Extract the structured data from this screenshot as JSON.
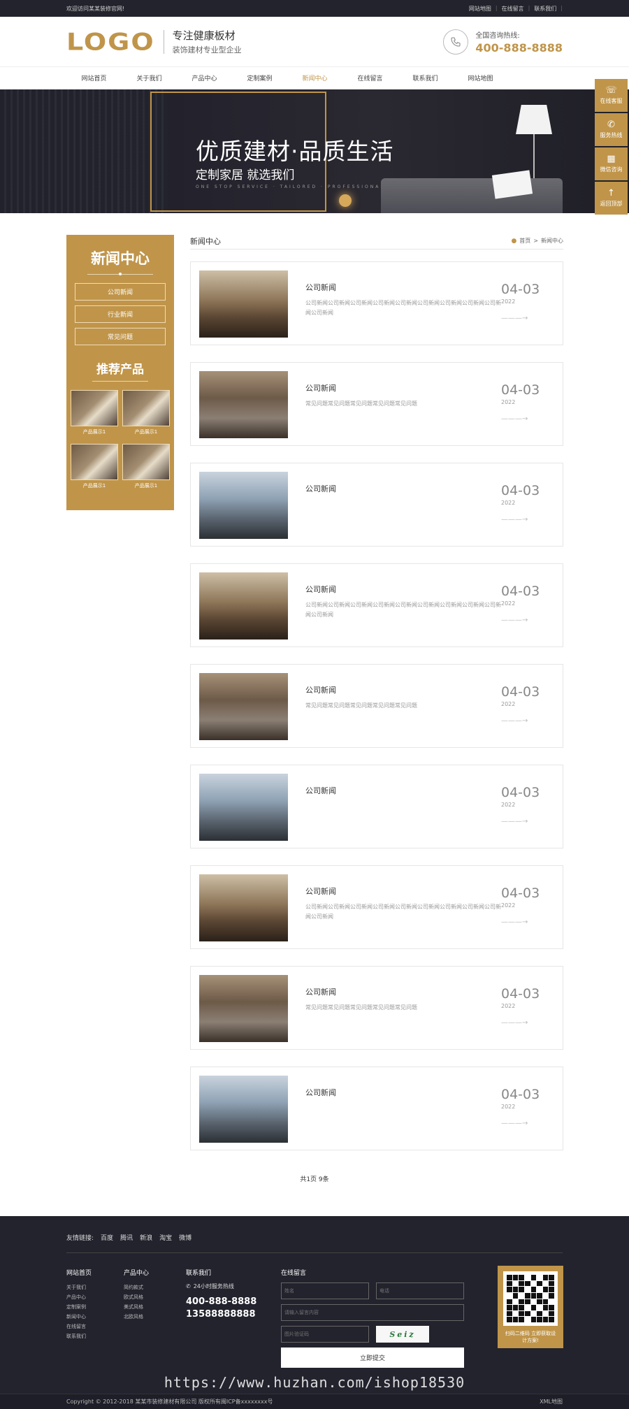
{
  "topbar": {
    "welcome": "欢迎访问某某装修官网!",
    "links": [
      "网站地图",
      "在线留言",
      "联系我们"
    ]
  },
  "header": {
    "logo": "LOGO",
    "slogan_main": "专注健康板材",
    "slogan_sub": "装饰建材专业型企业",
    "hotline_label": "全国咨询热线:",
    "hotline_number": "400-888-8888"
  },
  "nav": {
    "items": [
      "网站首页",
      "关于我们",
      "产品中心",
      "定制案例",
      "新闻中心",
      "在线留言",
      "联系我们",
      "网站地图"
    ],
    "active": "新闻中心"
  },
  "banner": {
    "title": "优质建材·品质生活",
    "subtitle": "定制家居 就选我们",
    "tagline": "ONE STOP SERVICE · TAILORED · PROFESSIONAL INTIMATE"
  },
  "side_float": [
    {
      "label": "在线客服",
      "icon": "headset-icon"
    },
    {
      "label": "服务热线",
      "icon": "phone-icon"
    },
    {
      "label": "微信咨询",
      "icon": "qr-icon"
    },
    {
      "label": "返回顶部",
      "icon": "up-arrow-icon"
    }
  ],
  "sidebar": {
    "heading": "新闻中心",
    "menu": [
      "公司新闻",
      "行业新闻",
      "常见问题"
    ],
    "products_heading": "推荐产品",
    "products": [
      "产品展示1",
      "产品展示1",
      "产品展示1",
      "产品展示1"
    ]
  },
  "content": {
    "section_name": "新闻中心",
    "breadcrumb_home": "首页",
    "breadcrumb_sep": ">",
    "breadcrumb_current": "新闻中心",
    "news": [
      {
        "title": "公司新闻",
        "desc": "公司新闻公司新闻公司新闻公司新闻公司新闻公司新闻公司新闻公司新闻公司新闻公司新闻",
        "md": "04-03",
        "year": "2022",
        "img": "style-a"
      },
      {
        "title": "公司新闻",
        "desc": "常见问题常见问题常见问题常见问题常见问题",
        "md": "04-03",
        "year": "2022",
        "img": "style-b"
      },
      {
        "title": "公司新闻",
        "desc": "",
        "md": "04-03",
        "year": "2022",
        "img": "style-c"
      },
      {
        "title": "公司新闻",
        "desc": "公司新闻公司新闻公司新闻公司新闻公司新闻公司新闻公司新闻公司新闻公司新闻公司新闻",
        "md": "04-03",
        "year": "2022",
        "img": "style-a"
      },
      {
        "title": "公司新闻",
        "desc": "常见问题常见问题常见问题常见问题常见问题",
        "md": "04-03",
        "year": "2022",
        "img": "style-b"
      },
      {
        "title": "公司新闻",
        "desc": "",
        "md": "04-03",
        "year": "2022",
        "img": "style-c"
      },
      {
        "title": "公司新闻",
        "desc": "公司新闻公司新闻公司新闻公司新闻公司新闻公司新闻公司新闻公司新闻公司新闻公司新闻",
        "md": "04-03",
        "year": "2022",
        "img": "style-a"
      },
      {
        "title": "公司新闻",
        "desc": "常见问题常见问题常见问题常见问题常见问题",
        "md": "04-03",
        "year": "2022",
        "img": "style-b"
      },
      {
        "title": "公司新闻",
        "desc": "",
        "md": "04-03",
        "year": "2022",
        "img": "style-c"
      }
    ],
    "pagination": "共1页 9条"
  },
  "footer": {
    "friend_links_label": "友情链接:",
    "friend_links": [
      "百度",
      "腾讯",
      "新浪",
      "淘宝",
      "微博"
    ],
    "col1": {
      "heading": "网站首页",
      "items": [
        "关于我们",
        "产品中心",
        "定制案例",
        "新闻中心",
        "在线留言",
        "联系我们"
      ]
    },
    "col2": {
      "heading": "产品中心",
      "items": [
        "简约款式",
        "欧式风格",
        "美式风格",
        "北欧风格"
      ]
    },
    "contact": {
      "heading": "联系我们",
      "sub": "24小时服务热线",
      "phone1": "400-888-8888",
      "phone2": "13588888888"
    },
    "form": {
      "heading": "在线留言",
      "name_placeholder": "姓名",
      "phone_placeholder": "电话",
      "content_placeholder": "请输入留言内容",
      "captcha_placeholder": "图片验证码",
      "captcha_text": "Seiz",
      "submit": "立即提交"
    },
    "qr_caption": "扫码二维码 立即获取设计方案!",
    "copyright": "Copyright © 2012-2018 某某市装修建材有限公司 版权所有闽ICP备xxxxxxxx号",
    "xml_map": "XML地图"
  },
  "watermark": "https://www.huzhan.com/ishop18530",
  "colors": {
    "accent": "#c0954a",
    "dark": "#22232d"
  }
}
